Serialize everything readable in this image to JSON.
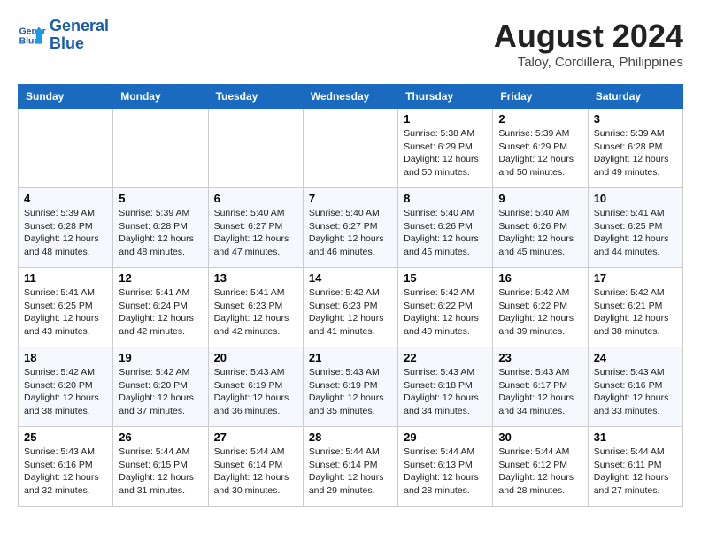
{
  "header": {
    "logo_line1": "General",
    "logo_line2": "Blue",
    "month_year": "August 2024",
    "location": "Taloy, Cordillera, Philippines"
  },
  "weekdays": [
    "Sunday",
    "Monday",
    "Tuesday",
    "Wednesday",
    "Thursday",
    "Friday",
    "Saturday"
  ],
  "weeks": [
    [
      {
        "day": "",
        "info": ""
      },
      {
        "day": "",
        "info": ""
      },
      {
        "day": "",
        "info": ""
      },
      {
        "day": "",
        "info": ""
      },
      {
        "day": "1",
        "info": "Sunrise: 5:38 AM\nSunset: 6:29 PM\nDaylight: 12 hours\nand 50 minutes."
      },
      {
        "day": "2",
        "info": "Sunrise: 5:39 AM\nSunset: 6:29 PM\nDaylight: 12 hours\nand 50 minutes."
      },
      {
        "day": "3",
        "info": "Sunrise: 5:39 AM\nSunset: 6:28 PM\nDaylight: 12 hours\nand 49 minutes."
      }
    ],
    [
      {
        "day": "4",
        "info": "Sunrise: 5:39 AM\nSunset: 6:28 PM\nDaylight: 12 hours\nand 48 minutes."
      },
      {
        "day": "5",
        "info": "Sunrise: 5:39 AM\nSunset: 6:28 PM\nDaylight: 12 hours\nand 48 minutes."
      },
      {
        "day": "6",
        "info": "Sunrise: 5:40 AM\nSunset: 6:27 PM\nDaylight: 12 hours\nand 47 minutes."
      },
      {
        "day": "7",
        "info": "Sunrise: 5:40 AM\nSunset: 6:27 PM\nDaylight: 12 hours\nand 46 minutes."
      },
      {
        "day": "8",
        "info": "Sunrise: 5:40 AM\nSunset: 6:26 PM\nDaylight: 12 hours\nand 45 minutes."
      },
      {
        "day": "9",
        "info": "Sunrise: 5:40 AM\nSunset: 6:26 PM\nDaylight: 12 hours\nand 45 minutes."
      },
      {
        "day": "10",
        "info": "Sunrise: 5:41 AM\nSunset: 6:25 PM\nDaylight: 12 hours\nand 44 minutes."
      }
    ],
    [
      {
        "day": "11",
        "info": "Sunrise: 5:41 AM\nSunset: 6:25 PM\nDaylight: 12 hours\nand 43 minutes."
      },
      {
        "day": "12",
        "info": "Sunrise: 5:41 AM\nSunset: 6:24 PM\nDaylight: 12 hours\nand 42 minutes."
      },
      {
        "day": "13",
        "info": "Sunrise: 5:41 AM\nSunset: 6:23 PM\nDaylight: 12 hours\nand 42 minutes."
      },
      {
        "day": "14",
        "info": "Sunrise: 5:42 AM\nSunset: 6:23 PM\nDaylight: 12 hours\nand 41 minutes."
      },
      {
        "day": "15",
        "info": "Sunrise: 5:42 AM\nSunset: 6:22 PM\nDaylight: 12 hours\nand 40 minutes."
      },
      {
        "day": "16",
        "info": "Sunrise: 5:42 AM\nSunset: 6:22 PM\nDaylight: 12 hours\nand 39 minutes."
      },
      {
        "day": "17",
        "info": "Sunrise: 5:42 AM\nSunset: 6:21 PM\nDaylight: 12 hours\nand 38 minutes."
      }
    ],
    [
      {
        "day": "18",
        "info": "Sunrise: 5:42 AM\nSunset: 6:20 PM\nDaylight: 12 hours\nand 38 minutes."
      },
      {
        "day": "19",
        "info": "Sunrise: 5:42 AM\nSunset: 6:20 PM\nDaylight: 12 hours\nand 37 minutes."
      },
      {
        "day": "20",
        "info": "Sunrise: 5:43 AM\nSunset: 6:19 PM\nDaylight: 12 hours\nand 36 minutes."
      },
      {
        "day": "21",
        "info": "Sunrise: 5:43 AM\nSunset: 6:19 PM\nDaylight: 12 hours\nand 35 minutes."
      },
      {
        "day": "22",
        "info": "Sunrise: 5:43 AM\nSunset: 6:18 PM\nDaylight: 12 hours\nand 34 minutes."
      },
      {
        "day": "23",
        "info": "Sunrise: 5:43 AM\nSunset: 6:17 PM\nDaylight: 12 hours\nand 34 minutes."
      },
      {
        "day": "24",
        "info": "Sunrise: 5:43 AM\nSunset: 6:16 PM\nDaylight: 12 hours\nand 33 minutes."
      }
    ],
    [
      {
        "day": "25",
        "info": "Sunrise: 5:43 AM\nSunset: 6:16 PM\nDaylight: 12 hours\nand 32 minutes."
      },
      {
        "day": "26",
        "info": "Sunrise: 5:44 AM\nSunset: 6:15 PM\nDaylight: 12 hours\nand 31 minutes."
      },
      {
        "day": "27",
        "info": "Sunrise: 5:44 AM\nSunset: 6:14 PM\nDaylight: 12 hours\nand 30 minutes."
      },
      {
        "day": "28",
        "info": "Sunrise: 5:44 AM\nSunset: 6:14 PM\nDaylight: 12 hours\nand 29 minutes."
      },
      {
        "day": "29",
        "info": "Sunrise: 5:44 AM\nSunset: 6:13 PM\nDaylight: 12 hours\nand 28 minutes."
      },
      {
        "day": "30",
        "info": "Sunrise: 5:44 AM\nSunset: 6:12 PM\nDaylight: 12 hours\nand 28 minutes."
      },
      {
        "day": "31",
        "info": "Sunrise: 5:44 AM\nSunset: 6:11 PM\nDaylight: 12 hours\nand 27 minutes."
      }
    ]
  ]
}
